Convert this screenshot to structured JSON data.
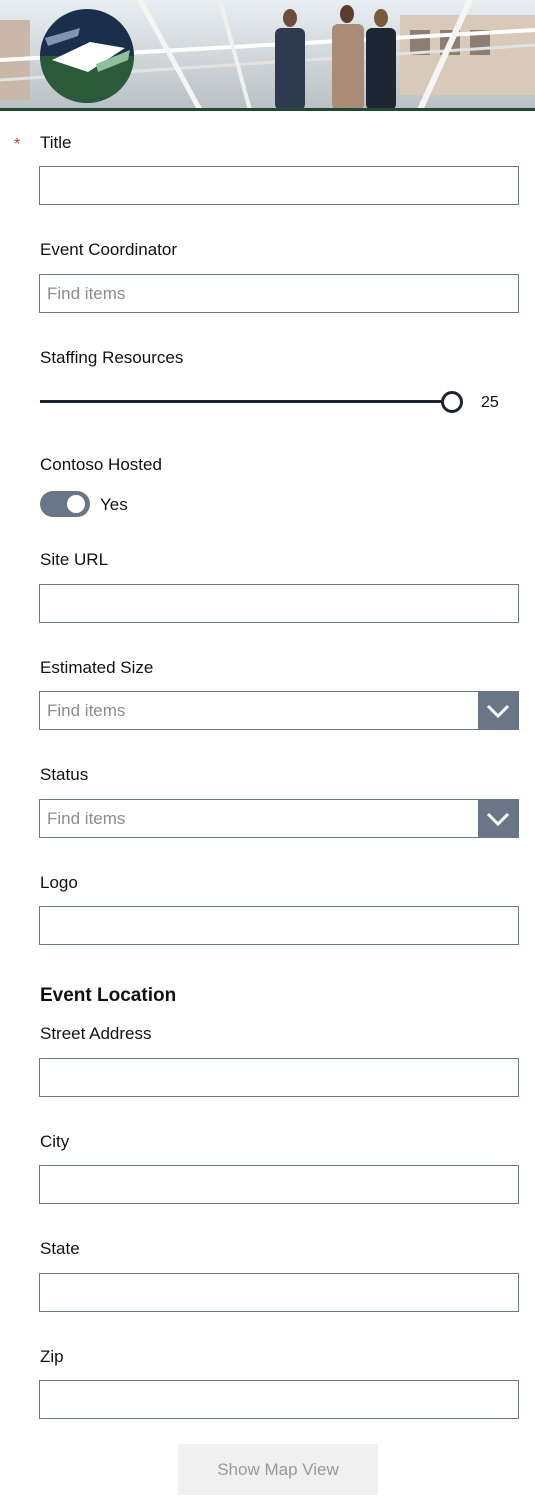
{
  "form": {
    "title": {
      "label": "Title",
      "required_marker": "*",
      "value": ""
    },
    "event_coordinator": {
      "label": "Event Coordinator",
      "placeholder": "Find items"
    },
    "staffing_resources": {
      "label": "Staffing Resources",
      "value": "25"
    },
    "contoso_hosted": {
      "label": "Contoso Hosted",
      "value_text": "Yes"
    },
    "site_url": {
      "label": "Site URL",
      "value": ""
    },
    "estimated_size": {
      "label": "Estimated Size",
      "placeholder": "Find items"
    },
    "status": {
      "label": "Status",
      "placeholder": "Find items"
    },
    "logo": {
      "label": "Logo",
      "value": ""
    },
    "event_location": {
      "heading": "Event Location"
    },
    "street_address": {
      "label": "Street Address",
      "value": ""
    },
    "city": {
      "label": "City",
      "value": ""
    },
    "state": {
      "label": "State",
      "value": ""
    },
    "zip": {
      "label": "Zip",
      "value": ""
    },
    "map_button": {
      "label": "Show Map View"
    }
  },
  "colors": {
    "accent": "#6b7588",
    "slider": "#1c2331",
    "required": "#c0392b",
    "header_rule": "#1f4a30"
  },
  "icons": {
    "dropdown": "chevron-down-icon",
    "logo": "contoso-logo"
  }
}
